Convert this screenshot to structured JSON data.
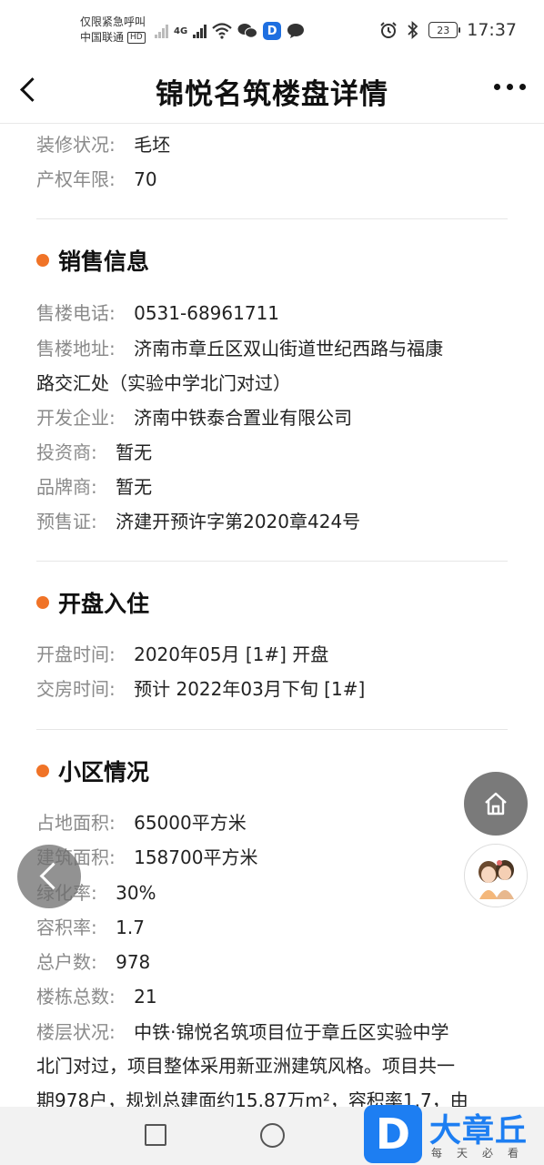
{
  "status_bar": {
    "carrier_line1": "仅限紧急呼叫",
    "carrier_line2": "中国联通",
    "hd_badge": "HD",
    "network": "4G",
    "battery": "23",
    "time": "17:37",
    "icons": [
      "signal-icon",
      "wifi-icon",
      "wechat-icon",
      "app-d-icon",
      "message-icon",
      "alarm-icon",
      "bluetooth-icon",
      "battery-icon"
    ]
  },
  "nav": {
    "title": "锦悦名筑楼盘详情"
  },
  "top_rows": [
    {
      "label": "装修状况:",
      "value": "毛坯"
    },
    {
      "label": "产权年限:",
      "value": "70"
    }
  ],
  "sections": [
    {
      "title": "销售信息",
      "rows": [
        {
          "label": "售楼电话:",
          "value": "0531-68961711"
        },
        {
          "label": "售楼地址:",
          "value": "济南市章丘区双山街道世纪西路与福康",
          "continuation": "路交汇处（实验中学北门对过）"
        },
        {
          "label": "开发企业:",
          "value": "济南中铁泰合置业有限公司"
        },
        {
          "label": "投资商:",
          "value": "暂无"
        },
        {
          "label": "品牌商:",
          "value": "暂无"
        },
        {
          "label": "预售证:",
          "value": "济建开预许字第2020章424号"
        }
      ]
    },
    {
      "title": "开盘入住",
      "rows": [
        {
          "label": "开盘时间:",
          "value": "2020年05月 [1#] 开盘"
        },
        {
          "label": "交房时间:",
          "value": "预计 2022年03月下旬 [1#]"
        }
      ]
    },
    {
      "title": "小区情况",
      "rows": [
        {
          "label": "占地面积:",
          "value": "65000平方米"
        },
        {
          "label": "建筑面积:",
          "value": "158700平方米"
        },
        {
          "label": "绿化率:",
          "value": "30%"
        },
        {
          "label": "容积率:",
          "value": "1.7"
        },
        {
          "label": "总户数:",
          "value": "978"
        },
        {
          "label": "楼栋总数:",
          "value": "21"
        },
        {
          "label": "楼层状况:",
          "value": "中铁·锦悦名筑项目位于章丘区实验中学",
          "continuation": "北门对过，项目整体采用新亚洲建筑风格。项目共一",
          "continuation2": "期978户，规划总建面约15.87万m²，容积率1.7，由"
        }
      ]
    }
  ],
  "watermark": {
    "letter": "D",
    "name": "大章丘",
    "slogan": "每天必看"
  },
  "colors": {
    "accent_dot": "#f07327",
    "label_gray": "#8a8a8a",
    "logo_blue": "#1d7ef2"
  }
}
